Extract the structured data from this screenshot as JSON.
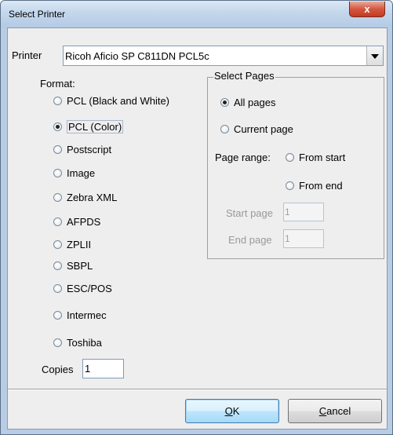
{
  "window": {
    "title": "Select Printer",
    "close_symbol": "x"
  },
  "printer": {
    "label": "Printer",
    "selected": "Ricoh Aficio SP C811DN PCL5c"
  },
  "format": {
    "label": "Format:",
    "options": [
      "PCL (Black and White)",
      "PCL (Color)",
      "Postscript",
      "Image",
      "Zebra XML",
      "AFPDS",
      "ZPLII",
      "SBPL",
      "ESC/POS",
      "Intermec",
      "Toshiba"
    ],
    "selected": "PCL (Color)"
  },
  "select_pages": {
    "title": "Select Pages",
    "all_pages": "All pages",
    "current_page": "Current page",
    "selected": "All pages",
    "page_range_label": "Page range:",
    "from_start": "From start",
    "from_end": "From end",
    "start_page_label": "Start page",
    "start_page_value": "1",
    "end_page_label": "End page",
    "end_page_value": "1"
  },
  "copies": {
    "label": "Copies",
    "value": "1"
  },
  "buttons": {
    "ok_mnemonic": "O",
    "ok_rest": "K",
    "cancel_mnemonic": "C",
    "cancel_rest": "ancel"
  }
}
